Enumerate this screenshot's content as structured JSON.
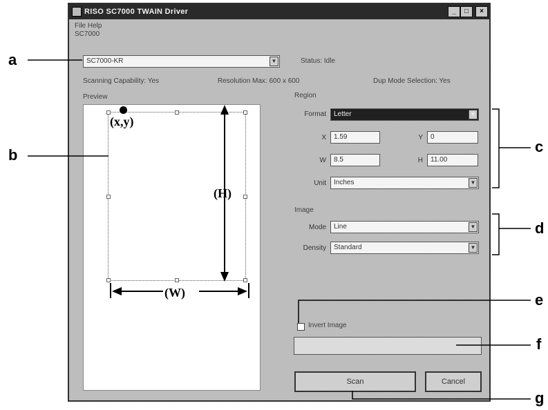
{
  "window": {
    "title": "RISO SC7000 TWAIN Driver",
    "min_label": "_",
    "max_label": "□",
    "close_label": "×"
  },
  "menu": {
    "line1": "File  Help",
    "line2": "SC7000"
  },
  "scanner_select": {
    "value": "SC7000-KR",
    "status_label": "Status: Idle"
  },
  "capabilities": {
    "scanning": "Scanning Capability: Yes",
    "resolution": "Resolution Max: 600 x 600",
    "duplex": "Dup Mode Selection: Yes"
  },
  "preview": {
    "label": "Preview",
    "origin_label": "(x,y)",
    "height_label": "(H)",
    "width_label": "(W)"
  },
  "region": {
    "label": "Region",
    "format_label": "Format",
    "format_value": "Letter",
    "x_label": "X",
    "x_value": "1.59",
    "y_label": "Y",
    "y_value": "0",
    "w_label": "W",
    "w_value": "8.5",
    "h_label": "H",
    "h_value": "11.00",
    "unit_label": "Unit",
    "unit_value": "Inches"
  },
  "image": {
    "label": "Image",
    "mode_label": "Mode",
    "mode_value": "Line",
    "density_label": "Density",
    "density_value": "Standard"
  },
  "invert": {
    "label": "Invert Image"
  },
  "buttons": {
    "scan": "Scan",
    "cancel": "Cancel"
  },
  "callouts": {
    "a": "a",
    "b": "b",
    "c": "c",
    "d": "d",
    "e": "e",
    "f": "f",
    "g": "g"
  }
}
